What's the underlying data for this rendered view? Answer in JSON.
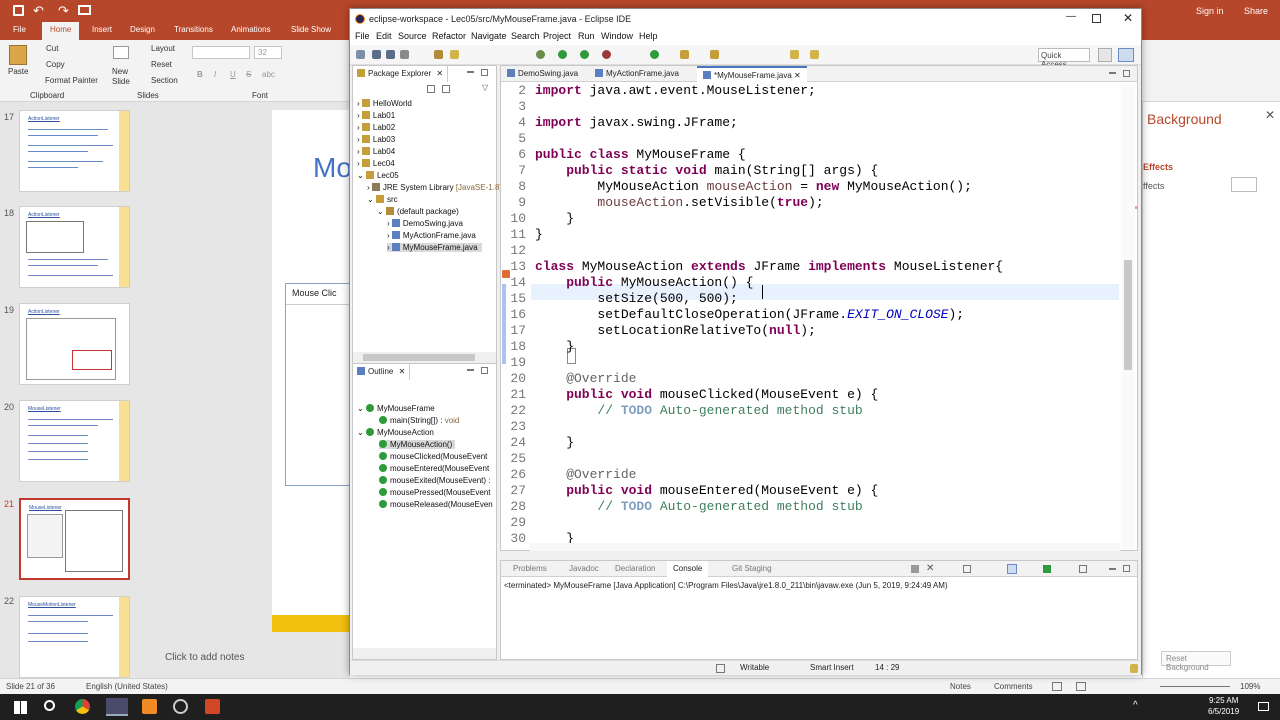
{
  "powerpoint": {
    "title_actions": [
      "Sign in",
      "Share"
    ],
    "tabs": [
      "File",
      "Home",
      "Insert",
      "Design",
      "Transitions",
      "Animations",
      "Slide Show"
    ],
    "ribbon": {
      "paste": "Paste",
      "cut": "Cut",
      "copy": "Copy",
      "format_painter": "Format Painter",
      "clipboard": "Clipboard",
      "new_slide": "New\nSlide",
      "layout": "Layout",
      "reset": "Reset",
      "section": "Section",
      "slides": "Slides",
      "font": "Font",
      "font_size": "32",
      "font_styles": [
        "B",
        "I",
        "U",
        "S",
        "abc"
      ]
    },
    "slide_numbers": [
      "17",
      "18",
      "19",
      "20",
      "21",
      "22"
    ],
    "thumb_titles": [
      "ActionListener",
      "ActionListener",
      "ActionListener",
      "MouseListener",
      "MouseListener",
      "MouseMotionListener"
    ],
    "canvas_title_fragment": "Mo",
    "canvas_window_fragment": "Mouse Clic",
    "notes": "Click to add notes",
    "status_left": "Slide 21 of 36",
    "language": "English (United States)",
    "right_pane": {
      "heading": "Background",
      "effects_tab": "Effects",
      "effects_label": "ffects",
      "reset_bg": "Reset Background"
    },
    "status_right": {
      "notes": "Notes",
      "comments": "Comments",
      "zoom": "109%"
    },
    "clock": {
      "time": "9:25 AM",
      "date": "6/5/2019"
    }
  },
  "eclipse": {
    "title": "eclipse-workspace - Lec05/src/MyMouseFrame.java - Eclipse IDE",
    "menu": [
      "File",
      "Edit",
      "Source",
      "Refactor",
      "Navigate",
      "Search",
      "Project",
      "Run",
      "Window",
      "Help"
    ],
    "quick_access": "Quick Access",
    "package_explorer": {
      "tab": "Package Explorer",
      "tree": [
        "HelloWorld",
        "Lab01",
        "Lab02",
        "Lab03",
        "Lab04",
        "Lec04",
        "Lec05",
        "JRE System Library",
        "[JavaSE-1.8]",
        "src",
        "(default package)",
        "DemoSwing.java",
        "MyActionFrame.java",
        "MyMouseFrame.java"
      ]
    },
    "outline": {
      "tab": "Outline",
      "items": [
        "MyMouseFrame",
        "main(String[])",
        "void",
        "MyMouseAction",
        "MyMouseAction()",
        "mouseClicked(MouseEvent",
        "mouseEntered(MouseEvent",
        "mouseExited(MouseEvent) :",
        "mousePressed(MouseEvent",
        "mouseReleased(MouseEven"
      ]
    },
    "editor_tabs": [
      "DemoSwing.java",
      "MyActionFrame.java",
      "*MyMouseFrame.java"
    ],
    "line_numbers": [
      "2",
      "3",
      "4",
      "5",
      "6",
      "7",
      "8",
      "9",
      "10",
      "11",
      "12",
      "13",
      "14",
      "15",
      "16",
      "17",
      "18",
      "19",
      "20",
      "21",
      "22",
      "23",
      "24",
      "25",
      "26",
      "27",
      "28",
      "29",
      "30"
    ],
    "code": {
      "l2a": "import",
      "l2b": " java.awt.event.MouseListener;",
      "l4a": "import",
      "l4b": " javax.swing.JFrame;",
      "l6a": "public class",
      "l6b": " MyMouseFrame {",
      "l7a": "    public static void",
      "l7b": " main(String[] args) {",
      "l8a": "        MyMouseAction ",
      "l8b": "mouseAction",
      "l8c": " = ",
      "l8d": "new",
      "l8e": " MyMouseAction();",
      "l9a": "        ",
      "l9b": "mouseAction",
      "l9c": ".setVisible(",
      "l9d": "true",
      "l9e": ");",
      "l10": "    }",
      "l11": "}",
      "l13a": "class",
      "l13b": " MyMouseAction ",
      "l13c": "extends",
      "l13d": " JFrame ",
      "l13e": "implements",
      "l13f": " MouseListener{",
      "l14a": "    public",
      "l14b": " MyMouseAction() {",
      "l15": "        setSize(500, 500);",
      "l16a": "        setDefaultCloseOperation(JFrame.",
      "l16b": "EXIT_ON_CLOSE",
      "l16c": ");",
      "l17a": "        setLocationRelativeTo(",
      "l17b": "null",
      "l17c": ");",
      "l18": "    }",
      "l20": "    @Override",
      "l21a": "    public void",
      "l21b": " mouseClicked(MouseEvent e) {",
      "l22a": "        // ",
      "l22b": "TODO",
      "l22c": " Auto-generated method stub",
      "l24": "    }",
      "l26": "    @Override",
      "l27a": "    public void",
      "l27b": " mouseEntered(MouseEvent e) {",
      "l28a": "        // ",
      "l28b": "TODO",
      "l28c": " Auto-generated method stub",
      "l30": "    }"
    },
    "bottom_tabs": [
      "Problems",
      "Javadoc",
      "Declaration",
      "Console",
      "Git Staging"
    ],
    "console_text": "<terminated> MyMouseFrame [Java Application] C:\\Program Files\\Java\\jre1.8.0_211\\bin\\javaw.exe (Jun 5, 2019, 9:24:49 AM)",
    "status": {
      "writable": "Writable",
      "insert": "Smart Insert",
      "position": "14 : 29"
    }
  }
}
